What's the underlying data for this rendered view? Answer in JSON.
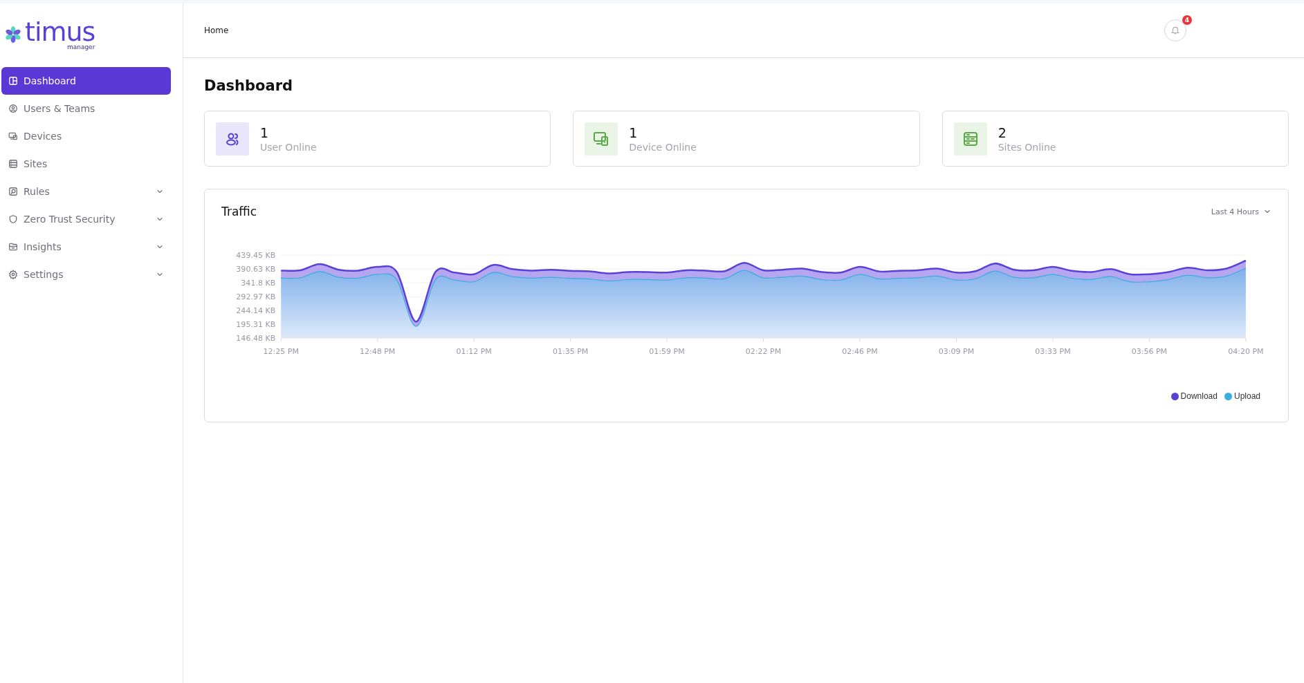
{
  "logo": {
    "name": "timus",
    "subtitle": "manager"
  },
  "sidebar": {
    "items": [
      {
        "label": "Dashboard",
        "selected": true,
        "expandable": false
      },
      {
        "label": "Users & Teams",
        "selected": false,
        "expandable": false
      },
      {
        "label": "Devices",
        "selected": false,
        "expandable": false
      },
      {
        "label": "Sites",
        "selected": false,
        "expandable": false
      },
      {
        "label": "Rules",
        "selected": false,
        "expandable": true
      },
      {
        "label": "Zero Trust Security",
        "selected": false,
        "expandable": true
      },
      {
        "label": "Insights",
        "selected": false,
        "expandable": true
      },
      {
        "label": "Settings",
        "selected": false,
        "expandable": true
      }
    ]
  },
  "header": {
    "breadcrumb": "Home",
    "notifications": {
      "count": "4"
    }
  },
  "page_title": "Dashboard",
  "stats": [
    {
      "value": "1",
      "label": "User Online",
      "color": "#5b3fd9"
    },
    {
      "value": "1",
      "label": "Device Online",
      "color": "#5aa846"
    },
    {
      "value": "2",
      "label": "Sites Online",
      "color": "#5aa846"
    }
  ],
  "traffic": {
    "title": "Traffic",
    "range": "Last 4 Hours",
    "chart_data": {
      "type": "area",
      "categories": [
        "12:25 PM",
        null,
        null,
        null,
        null,
        "12:48 PM",
        null,
        null,
        null,
        null,
        "01:12 PM",
        null,
        null,
        null,
        null,
        "01:35 PM",
        null,
        null,
        null,
        null,
        "01:59 PM",
        null,
        null,
        null,
        null,
        "02:22 PM",
        null,
        null,
        null,
        null,
        "02:46 PM",
        null,
        null,
        null,
        null,
        "03:09 PM",
        null,
        null,
        null,
        null,
        "03:33 PM",
        null,
        null,
        null,
        null,
        "03:56 PM",
        null,
        null,
        null,
        null,
        "04:20 PM"
      ],
      "series": [
        {
          "name": "Download",
          "color": "#5b3fd9",
          "values": [
            385,
            386,
            408,
            388,
            385,
            398,
            380,
            205,
            380,
            378,
            372,
            405,
            390,
            385,
            388,
            384,
            382,
            375,
            380,
            380,
            378,
            386,
            385,
            383,
            412,
            386,
            388,
            392,
            380,
            378,
            398,
            382,
            384,
            386,
            392,
            378,
            383,
            410,
            388,
            386,
            398,
            384,
            380,
            390,
            372,
            372,
            380,
            395,
            386,
            392,
            420
          ]
        },
        {
          "name": "Upload",
          "color": "#3aaee0",
          "values": [
            360,
            361,
            383,
            363,
            360,
            373,
            355,
            190,
            355,
            353,
            347,
            380,
            365,
            360,
            363,
            359,
            357,
            350,
            355,
            355,
            353,
            361,
            360,
            358,
            387,
            361,
            363,
            367,
            355,
            353,
            373,
            357,
            359,
            361,
            367,
            353,
            358,
            385,
            363,
            361,
            373,
            359,
            355,
            365,
            347,
            347,
            355,
            370,
            361,
            367,
            395
          ]
        }
      ],
      "ylim": [
        146.48,
        439.45
      ],
      "grid": true,
      "yticks": [
        {
          "value": 146.48,
          "label": "146.48 KB"
        },
        {
          "value": 195.31,
          "label": "195.31 KB"
        },
        {
          "value": 244.14,
          "label": "244.14 KB"
        },
        {
          "value": 292.97,
          "label": "292.97 KB"
        },
        {
          "value": 341.8,
          "label": "341.8 KB"
        },
        {
          "value": 390.63,
          "label": "390.63 KB"
        },
        {
          "value": 439.45,
          "label": "439.45 KB"
        }
      ]
    }
  }
}
